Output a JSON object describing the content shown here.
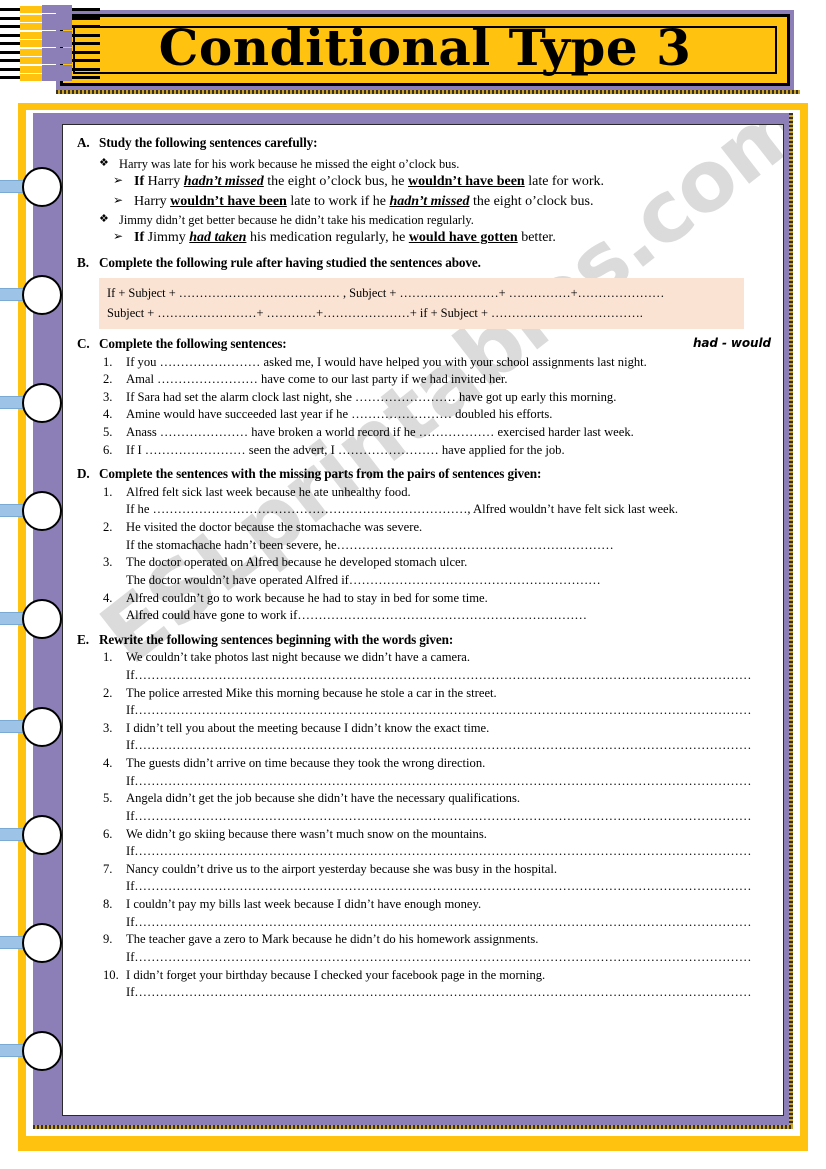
{
  "title": "Conditional Type 3",
  "watermark": "ESLprintables.com",
  "colors": {
    "banner_yellow": "#FFC20E",
    "frame_purple": "#8c7fb8",
    "rule_box_peach": "#FBE3D4",
    "ring_tab_blue": "#9dc3e6"
  },
  "icons": {
    "diamond_bullet": "❖",
    "arrow_bullet": "➢"
  },
  "sections": {
    "a": {
      "letter": "A.",
      "heading": "Study the following sentences carefully:",
      "items": [
        {
          "type": "diamond",
          "text": "Harry was late for his work because he missed the eight o’clock bus."
        },
        {
          "type": "arrow",
          "html": "<b>If</b> Harry <i class=\"bi\"><u>hadn’t missed</u></i> the eight o’clock bus, he <u class=\"bw\">wouldn’t have been</u> late for work.",
          "plain": "If Harry hadn’t missed the eight o’clock bus, he wouldn’t have been late for work."
        },
        {
          "type": "arrow",
          "html": "Harry <u class=\"bw\">wouldn’t have been</u> late to work if he <i class=\"bi\"><u>hadn’t missed</u></i> the eight o’clock bus.",
          "plain": "Harry wouldn’t have been late to work if he hadn’t missed the eight o’clock bus."
        },
        {
          "type": "diamond",
          "text": "Jimmy didn’t get better because he didn’t take his medication regularly."
        },
        {
          "type": "arrow",
          "html": "<b>If</b> Jimmy <i class=\"bi\"><u>had taken</u></i> his medication regularly, he <u class=\"bw\">would have gotten</u> better.",
          "plain": "If Jimmy had taken his medication regularly, he would have gotten better."
        }
      ]
    },
    "b": {
      "letter": "B.",
      "heading": "Complete the following rule after having studied the sentences above.",
      "rule_line_1": "If + Subject + ………………………………… , Subject + ……………………+  ……………+…………………",
      "rule_line_2": "Subject + ……………………+  …………+…………………+ if + Subject + ………………………………."
    },
    "c": {
      "letter": "C.",
      "heading": "Complete the following sentences:",
      "cue": "had  -  would",
      "items": [
        {
          "n": "1.",
          "text": "If you …………………… asked me, I would have helped you with your school assignments last night."
        },
        {
          "n": "2.",
          "text": "Amal …………………… have come to our last party if we had invited her."
        },
        {
          "n": "3.",
          "text": "If Sara had set the alarm clock last night, she …………………… have got up early this morning."
        },
        {
          "n": "4.",
          "text": "Amine would have succeeded last year if he …………………… doubled his efforts."
        },
        {
          "n": "5.",
          "text": "Anass ………………… have broken a world record if he ……………… exercised harder last week."
        },
        {
          "n": "6.",
          "text": "If I …………………… seen the advert, I …………………… have applied for the job."
        }
      ]
    },
    "d": {
      "letter": "D.",
      "heading": "Complete the sentences with the missing parts from the pairs of sentences given:",
      "items": [
        {
          "n": "1.",
          "text": "Alfred felt sick last week because he ate unhealthy food.",
          "answer": "If he …………………………………………………………………, Alfred wouldn’t have felt sick last week."
        },
        {
          "n": "2.",
          "text": "He visited the doctor because the stomachache was severe.",
          "answer": "If the stomachache hadn’t been severe, he…………………………………………………………"
        },
        {
          "n": "3.",
          "text": "The doctor operated on Alfred because he developed stomach ulcer.",
          "answer": "The doctor wouldn’t have operated Alfred if……………………………………………………"
        },
        {
          "n": "4.",
          "text": "Alfred couldn’t go to work because he had to stay in bed for some time.",
          "answer": "Alfred could have gone to work if……………………………………………………………"
        }
      ]
    },
    "e": {
      "letter": "E.",
      "heading": "Rewrite the following sentences beginning with the words given:",
      "answer_prefix": "If",
      "answer_line": "If…………………………………………………………………………………………………………………………………",
      "items": [
        {
          "n": "1.",
          "text": "We couldn’t take photos last night because we didn’t have a camera."
        },
        {
          "n": "2.",
          "text": "The police arrested Mike this morning because he stole a car in the street."
        },
        {
          "n": "3.",
          "text": "I didn’t tell you about the meeting because I didn’t know the exact time."
        },
        {
          "n": "4.",
          "text": "The guests didn’t arrive on time because they took the wrong direction."
        },
        {
          "n": "5.",
          "text": "Angela didn’t get the job because she didn’t have the necessary qualifications."
        },
        {
          "n": "6.",
          "text": "We didn’t go skiing because there wasn’t much snow on the mountains."
        },
        {
          "n": "7.",
          "text": "Nancy couldn’t drive us to the airport yesterday because she was busy in the hospital."
        },
        {
          "n": "8.",
          "text": "I couldn’t pay my bills last week because I didn’t have enough money."
        },
        {
          "n": "9.",
          "text": "The teacher gave a zero to Mark because he didn’t do his homework assignments."
        },
        {
          "n": "10.",
          "text": "I didn’t forget your birthday because I checked your facebook page in the morning."
        }
      ]
    }
  }
}
